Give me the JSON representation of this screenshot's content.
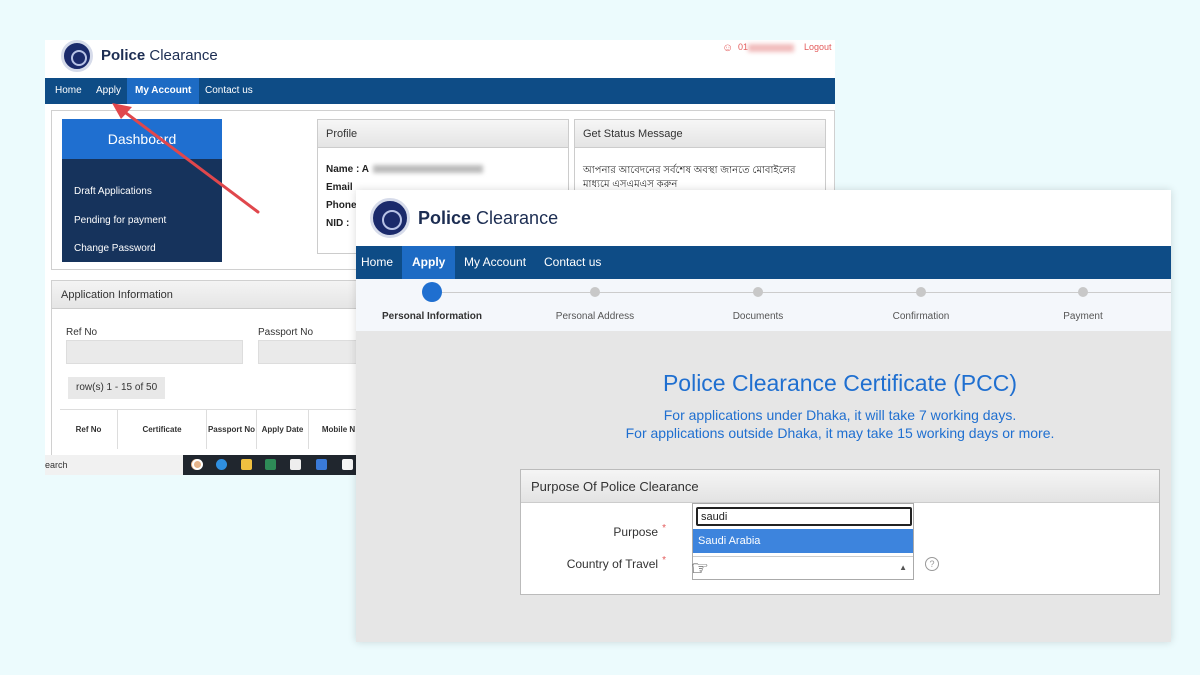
{
  "back_window": {
    "brand_bold": "Police",
    "brand_rest": " Clearance",
    "user_phone": "01",
    "logout": "Logout",
    "nav": [
      "Home",
      "Apply",
      "My Account",
      "Contact us"
    ],
    "nav_active_index": 2,
    "dashboard": {
      "title": "Dashboard",
      "items": [
        "Draft Applications",
        "Pending for payment",
        "Change Password"
      ]
    },
    "profile": {
      "title": "Profile",
      "fields": [
        "Name : A",
        "Email",
        "Phone",
        "NID :"
      ]
    },
    "status": {
      "title": "Get Status Message",
      "text": "আপনার আবেদনের সর্বশেষ অবস্থা জানতে মোবাইলের মাধ্যমে এসএমএস করুন"
    },
    "app_info": {
      "title": "Application Information",
      "ref_label": "Ref No",
      "passport_label": "Passport No",
      "row_count": "row(s) 1 - 15 of 50",
      "columns": [
        "Ref No",
        "Certificate",
        "Passport No",
        "Apply Date",
        "Mobile N"
      ]
    },
    "taskbar_search": "earch"
  },
  "front_window": {
    "brand_bold": "Police",
    "brand_rest": " Clearance",
    "nav": [
      "Home",
      "Apply",
      "My Account",
      "Contact us"
    ],
    "nav_active_index": 1,
    "steps": [
      "Personal Information",
      "Personal Address",
      "Documents",
      "Confirmation",
      "Payment"
    ],
    "current_step": 0,
    "title": "Police Clearance Certificate (PCC)",
    "subtitle_1": "For applications under Dhaka, it will take 7 working days.",
    "subtitle_2": "For applications outside Dhaka, it may take 15 working days or more.",
    "section_title": "Purpose Of Police Clearance",
    "purpose_label": "Purpose",
    "country_label": "Country of Travel",
    "search_value": "saudi",
    "dropdown_option": "Saudi Arabia",
    "help_icon": "?"
  },
  "colors": {
    "nav_bg": "#0e4c86",
    "nav_active": "#1d6bc4",
    "accent": "#1f6fd0",
    "annotation_arrow": "#e0474c",
    "page_bg": "#ecfbfd"
  }
}
